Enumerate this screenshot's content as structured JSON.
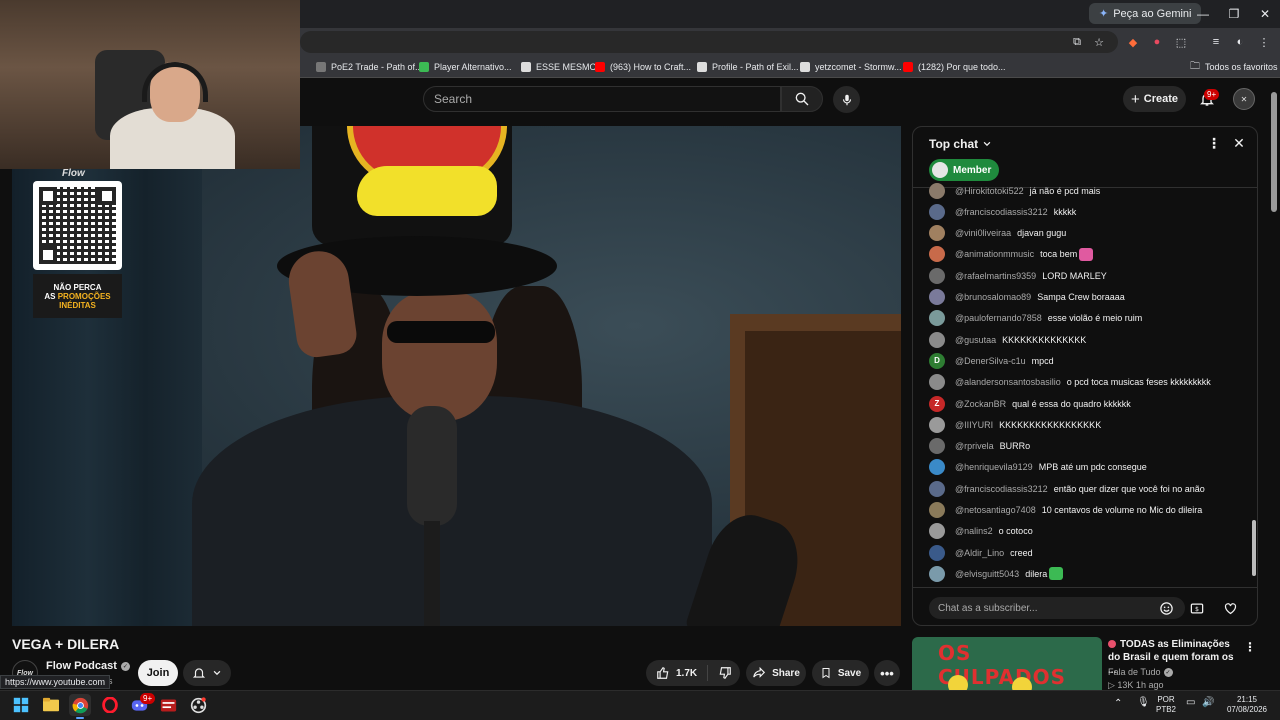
{
  "browser": {
    "gemini_label": "Peça ao Gemini",
    "window_controls": [
      "minimize",
      "restore",
      "close"
    ],
    "bookmarks": [
      {
        "label": "PoE2 Trade - Path of...",
        "color": "#777777"
      },
      {
        "label": "Player Alternativo...",
        "color": "#3cba54"
      },
      {
        "label": "ESSE MESMO",
        "color": "#dddddd"
      },
      {
        "label": "(963) How to Craft...",
        "color": "#ff0000"
      },
      {
        "label": "Profile - Path of Exil...",
        "color": "#dddddd"
      },
      {
        "label": "yetzcomet - Stormw...",
        "color": "#dddddd"
      },
      {
        "label": "(1282) Por que todo...",
        "color": "#ff0000"
      }
    ],
    "all_bookmarks": "Todos os favoritos",
    "status_url": "https://www.youtube.com"
  },
  "header": {
    "search_placeholder": "Search",
    "create_label": "Create",
    "notif_badge": "9+"
  },
  "video": {
    "title": "VEGA + DILERA",
    "overlay_logo": "Flow",
    "promo_line1": "NÃO PERCA",
    "promo_line2": "AS",
    "promo_highlight": "PROMOÇÕES",
    "promo_line3": "INÉDITAS"
  },
  "channel": {
    "name": "Flow Podcast",
    "subs_fragment": "ers",
    "avatar_text": "Flow",
    "join_label": "Join"
  },
  "actions": {
    "likes": "1.7K",
    "share_label": "Share",
    "save_label": "Save"
  },
  "chat": {
    "mode_label": "Top chat",
    "member_label": "Member",
    "input_placeholder": "Chat as a subscriber...",
    "messages": [
      {
        "author": "@Hirokitotoki522",
        "text": "já não é pcd mais",
        "color": "#8a7a6a"
      },
      {
        "author": "@franciscodiassis3212",
        "text": "kkkkk",
        "color": "#5a6a8a"
      },
      {
        "author": "@vini0liveiraa",
        "text": "djavan gugu",
        "color": "#a08060"
      },
      {
        "author": "@animationmmusic",
        "text": "toca bem",
        "color": "#c86a4a",
        "emoji_color": "#e05aa0"
      },
      {
        "author": "@rafaelmartins9359",
        "text": "LORD MARLEY",
        "color": "#6a6a6a"
      },
      {
        "author": "@brunosalomao89",
        "text": "Sampa Crew boraaaa",
        "color": "#7a7a9a"
      },
      {
        "author": "@paulofernando7858",
        "text": "esse violão é meio ruim",
        "color": "#7a9a9a"
      },
      {
        "author": "@gusutaa",
        "text": "KKKKKKKKKKKKKK",
        "color": "#8a8a8a"
      },
      {
        "author": "@DenerSilva-c1u",
        "text": "mpcd",
        "color": "#2e7d32",
        "initial": "D"
      },
      {
        "author": "@alandersonsantosbasilio",
        "text": "o pcd toca musicas feses kkkkkkkkk",
        "color": "#8a8a8a"
      },
      {
        "author": "@ZockanBR",
        "text": "qual é essa do quadro kkkkkk",
        "color": "#c62828",
        "initial": "Z"
      },
      {
        "author": "@IIIYURI",
        "text": "KKKKKKKKKKKKKKKKK",
        "color": "#9a9a9a"
      },
      {
        "author": "@rprivela",
        "text": "BURRo",
        "color": "#6a6a6a"
      },
      {
        "author": "@henriquevila9129",
        "text": "MPB até um pdc consegue",
        "color": "#3a8ac8"
      },
      {
        "author": "@franciscodiassis3212",
        "text": "então quer dizer que você foi no anão",
        "color": "#5a6a8a"
      },
      {
        "author": "@netosantiago7408",
        "text": "10 centavos de volume no Mic do dileira",
        "color": "#8a7a5a"
      },
      {
        "author": "@nalins2",
        "text": "o cotoco",
        "color": "#9a9a9a"
      },
      {
        "author": "@Aldir_Lino",
        "text": "creed",
        "color": "#3a5a8a"
      },
      {
        "author": "@elvisguitt5043",
        "text": "dilera",
        "color": "#7a9aaa",
        "emoji_color": "#3cba54"
      }
    ]
  },
  "recommended": {
    "thumb_text": "OS CULPADOS",
    "title": "TODAS as Eliminações do Brasil e quem foram os ...",
    "channel": "Fala de Tudo",
    "meta": "▷ 13K  1h ago"
  },
  "taskbar": {
    "lang_top": "POR",
    "lang_bottom": "PTB2",
    "time": "21:15",
    "date": "07/08/2026",
    "discord_badge": "9+"
  }
}
